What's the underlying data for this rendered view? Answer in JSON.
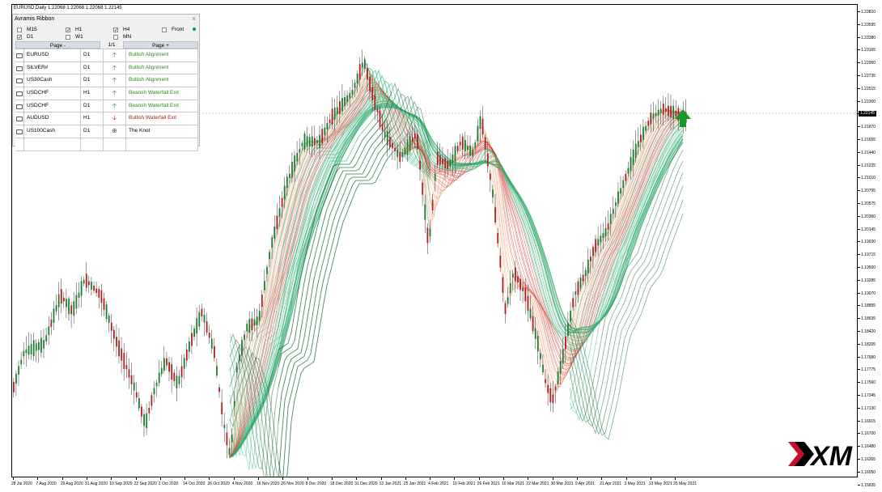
{
  "chart": {
    "symbol_header": "EURUSD,Daily  1.22068 1.22068 1.22068 1.22145",
    "current_price": "1.22145",
    "price_ticks": [
      "1.23810",
      "1.23595",
      "1.23380",
      "1.23165",
      "1.22950",
      "1.22735",
      "1.22515",
      "1.22300",
      "1.22085",
      "1.21870",
      "1.21655",
      "1.21440",
      "1.21225",
      "1.21010",
      "1.20795",
      "1.20575",
      "1.20360",
      "1.20145",
      "1.19930",
      "1.19715",
      "1.19500",
      "1.19285",
      "1.19070",
      "1.18855",
      "1.18635",
      "1.18420",
      "1.18205",
      "1.17990",
      "1.17775",
      "1.17560",
      "1.17345",
      "1.17130",
      "1.16915",
      "1.16700",
      "1.16480",
      "1.16265",
      "1.16050",
      "1.15835"
    ],
    "time_ticks": [
      "28 Jul 2020",
      "7 Aug 2020",
      "19 Aug 2020",
      "31 Aug 2020",
      "10 Sep 2020",
      "22 Sep 2020",
      "2 Oct 2020",
      "14 Oct 2020",
      "26 Oct 2020",
      "4 Nov 2020",
      "16 Nov 2020",
      "26 Nov 2020",
      "8 Dec 2020",
      "18 Dec 2020",
      "31 Dec 2020",
      "13 Jan 2021",
      "25 Jan 2021",
      "4 Feb 2021",
      "16 Feb 2021",
      "26 Feb 2021",
      "10 Mar 2021",
      "22 Mar 2021",
      "30 Mar 2021",
      "9 Apr 2021",
      "21 Apr 2021",
      "3 May 2021",
      "13 May 2021",
      "25 May 2021"
    ],
    "colors": {
      "bull_candle": "#1e7d32",
      "bear_candle": "#b21f1f",
      "ribbon_green": "#2fa86a",
      "ribbon_red": "#c9301f",
      "ribbon_orange": "#ee7a3a",
      "signal_arrow": "#159a25"
    },
    "signal_icon": "up-arrow-icon"
  },
  "panel": {
    "title": "Avramis Ribbon",
    "close_glyph": "×",
    "timeframes": [
      {
        "label": "M15",
        "checked": false
      },
      {
        "label": "H1",
        "checked": true
      },
      {
        "label": "H4",
        "checked": true
      },
      {
        "label": "Front",
        "checked": false
      },
      {
        "label": "D1",
        "checked": true
      },
      {
        "label": "W1",
        "checked": false
      },
      {
        "label": "MN",
        "checked": false
      }
    ],
    "check_mark": "✓",
    "page_prev": "Page -",
    "page_indicator": "1/1",
    "page_next": "Page +",
    "rows": [
      {
        "symbol": "EURUSD",
        "tf": "D1",
        "arrow": "🡡",
        "arrow_color": "#1b8a1b",
        "signal": "Bullish Alignment",
        "signal_color": "#2c8a1c"
      },
      {
        "symbol": "SILVER#",
        "tf": "D1",
        "arrow": "🡡",
        "arrow_color": "#1b8a1b",
        "signal": "Bullish Alignment",
        "signal_color": "#2c8a1c"
      },
      {
        "symbol": "US30Cash",
        "tf": "D1",
        "arrow": "🡡",
        "arrow_color": "#1b8a1b",
        "signal": "Bullish Alignment",
        "signal_color": "#2c8a1c"
      },
      {
        "symbol": "USDCHF",
        "tf": "H1",
        "arrow": "🡡",
        "arrow_color": "#1b8a1b",
        "signal": "Bearish Waterfall Exit",
        "signal_color": "#2c8a1c"
      },
      {
        "symbol": "USDCHF",
        "tf": "D1",
        "arrow": "🡡",
        "arrow_color": "#1b8a1b",
        "signal": "Bearish Waterfall Exit",
        "signal_color": "#2c8a1c"
      },
      {
        "symbol": "AUDUSD",
        "tf": "H1",
        "arrow": "🡣",
        "arrow_color": "#a51c1c",
        "signal": "Bullish Waterfall Exit",
        "signal_color": "#a51c1c"
      },
      {
        "symbol": "US100Cash",
        "tf": "D1",
        "arrow": "⊕",
        "arrow_color": "#555555",
        "signal": "The Knot",
        "signal_color": "#000000"
      },
      {
        "symbol": "",
        "tf": "",
        "arrow": "",
        "arrow_color": "#000000",
        "signal": "",
        "signal_color": "#000000"
      }
    ]
  },
  "branding": {
    "logo_text": "XM",
    "logo_icon": "xm-logo-icon"
  }
}
